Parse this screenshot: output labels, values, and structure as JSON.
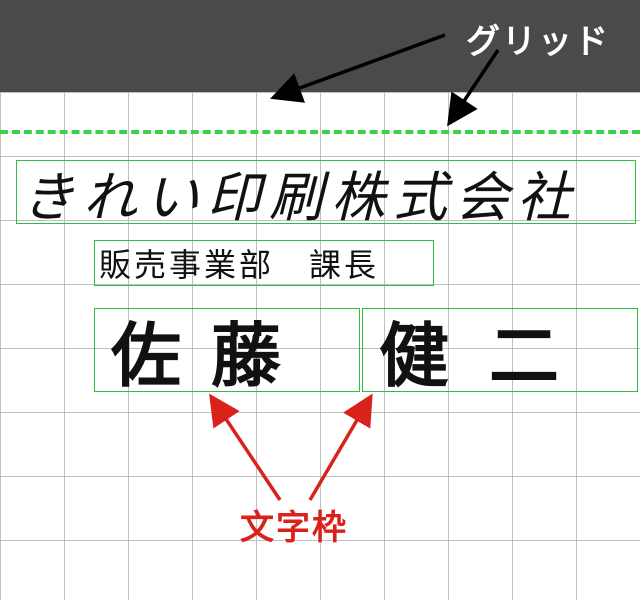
{
  "header": {
    "grid_label": "グリッド"
  },
  "text_frames": {
    "company": "きれい印刷株式会社",
    "department": "販売事業部　課長",
    "name_family": "佐藤",
    "name_given": "健二"
  },
  "footer": {
    "frame_label": "文字枠"
  },
  "colors": {
    "grid_line": "#bfbfbf",
    "green_frame": "#2fbf3f",
    "green_dash": "#3bd24b",
    "header_bg": "#4a4a4a",
    "arrow_black": "#000000",
    "arrow_red": "#d9221a"
  }
}
